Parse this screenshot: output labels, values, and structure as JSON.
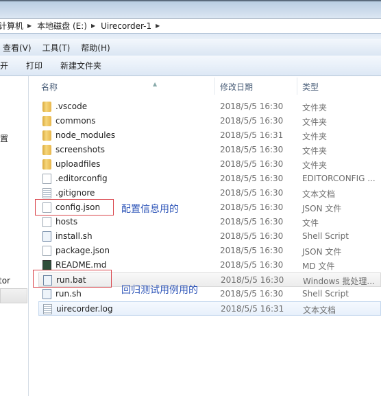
{
  "breadcrumb": [
    "计算机",
    "本地磁盘 (E:)",
    "Uirecorder-1"
  ],
  "menu": [
    "查看(V)",
    "工具(T)",
    "帮助(H)"
  ],
  "toolbar": [
    "打开",
    "打印",
    "新建文件夹"
  ],
  "sidebar": [
    "位置",
    "tor"
  ],
  "columns": {
    "name": "名称",
    "date": "修改日期",
    "type": "类型"
  },
  "files": [
    {
      "name": ".vscode",
      "date": "2018/5/5 16:30",
      "type": "文件夹",
      "icon": "folder"
    },
    {
      "name": "commons",
      "date": "2018/5/5 16:30",
      "type": "文件夹",
      "icon": "folder"
    },
    {
      "name": "node_modules",
      "date": "2018/5/5 16:31",
      "type": "文件夹",
      "icon": "folder"
    },
    {
      "name": "screenshots",
      "date": "2018/5/5 16:30",
      "type": "文件夹",
      "icon": "folder"
    },
    {
      "name": "uploadfiles",
      "date": "2018/5/5 16:30",
      "type": "文件夹",
      "icon": "folder"
    },
    {
      "name": ".editorconfig",
      "date": "2018/5/5 16:30",
      "type": "EDITORCONFIG ...",
      "icon": "file"
    },
    {
      "name": ".gitignore",
      "date": "2018/5/5 16:30",
      "type": "文本文档",
      "icon": "text-file"
    },
    {
      "name": "config.json",
      "date": "2018/5/5 16:30",
      "type": "JSON 文件",
      "icon": "file"
    },
    {
      "name": "hosts",
      "date": "2018/5/5 16:30",
      "type": "文件",
      "icon": "file"
    },
    {
      "name": "install.sh",
      "date": "2018/5/5 16:30",
      "type": "Shell Script",
      "icon": "script"
    },
    {
      "name": "package.json",
      "date": "2018/5/5 16:30",
      "type": "JSON 文件",
      "icon": "file"
    },
    {
      "name": "README.md",
      "date": "2018/5/5 16:30",
      "type": "MD 文件",
      "icon": "markdown"
    },
    {
      "name": "run.bat",
      "date": "2018/5/5 16:30",
      "type": "Windows 批处理...",
      "icon": "script"
    },
    {
      "name": "run.sh",
      "date": "2018/5/5 16:30",
      "type": "Shell Script",
      "icon": "script"
    },
    {
      "name": "uirecorder.log",
      "date": "2018/5/5 16:31",
      "type": "文本文档",
      "icon": "text-file"
    }
  ],
  "annotations": {
    "config": "配置信息用的",
    "run": "回归测试用例用的"
  }
}
